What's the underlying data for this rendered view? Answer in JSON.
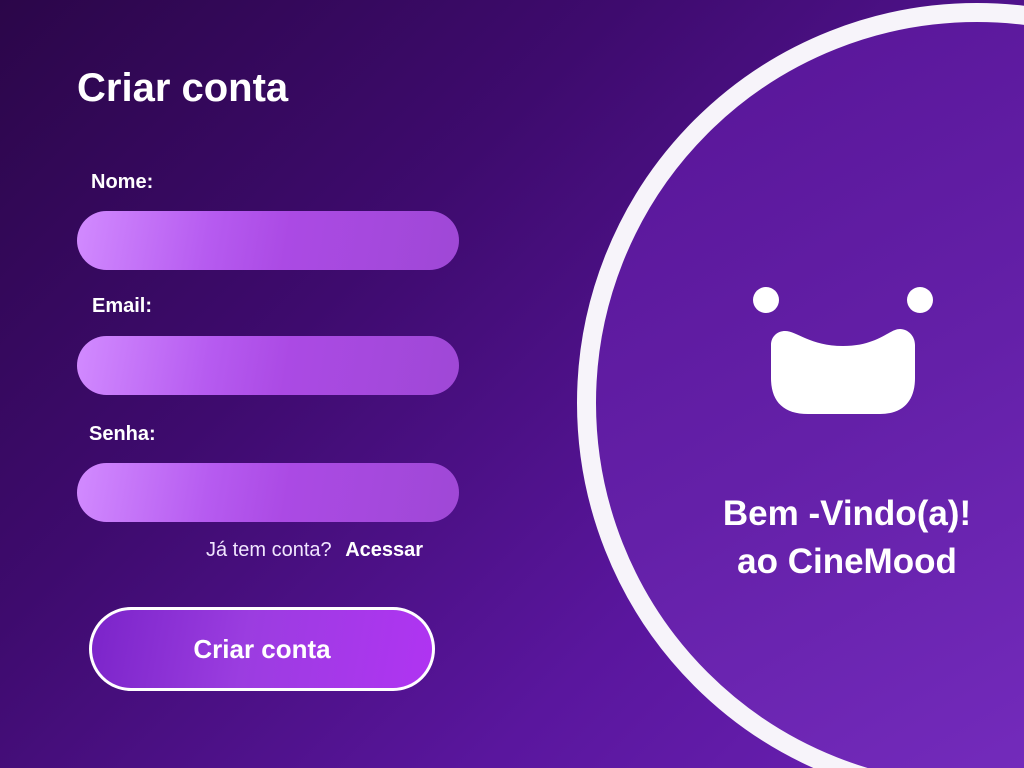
{
  "form": {
    "title": "Criar conta",
    "fields": [
      {
        "label": "Nome:",
        "value": "",
        "placeholder": ""
      },
      {
        "label": "Email:",
        "value": "",
        "placeholder": ""
      },
      {
        "label": "Senha:",
        "value": "",
        "placeholder": ""
      }
    ],
    "login_prompt": "Já tem conta?",
    "login_link": "Acessar",
    "submit_label": "Criar conta"
  },
  "welcome": {
    "line1": "Bem -Vindo(a)!",
    "line2": "ao CineMood",
    "logo_icon": "smiley-logo-icon"
  },
  "colors": {
    "background_dark": "#2b0649",
    "background_light": "#6c23b5",
    "input_gradient_start": "#d28bff",
    "input_gradient_end": "#9f48d6",
    "button_gradient_end": "#b034f2",
    "circle_border": "#f7f4fa",
    "text": "#ffffff"
  }
}
